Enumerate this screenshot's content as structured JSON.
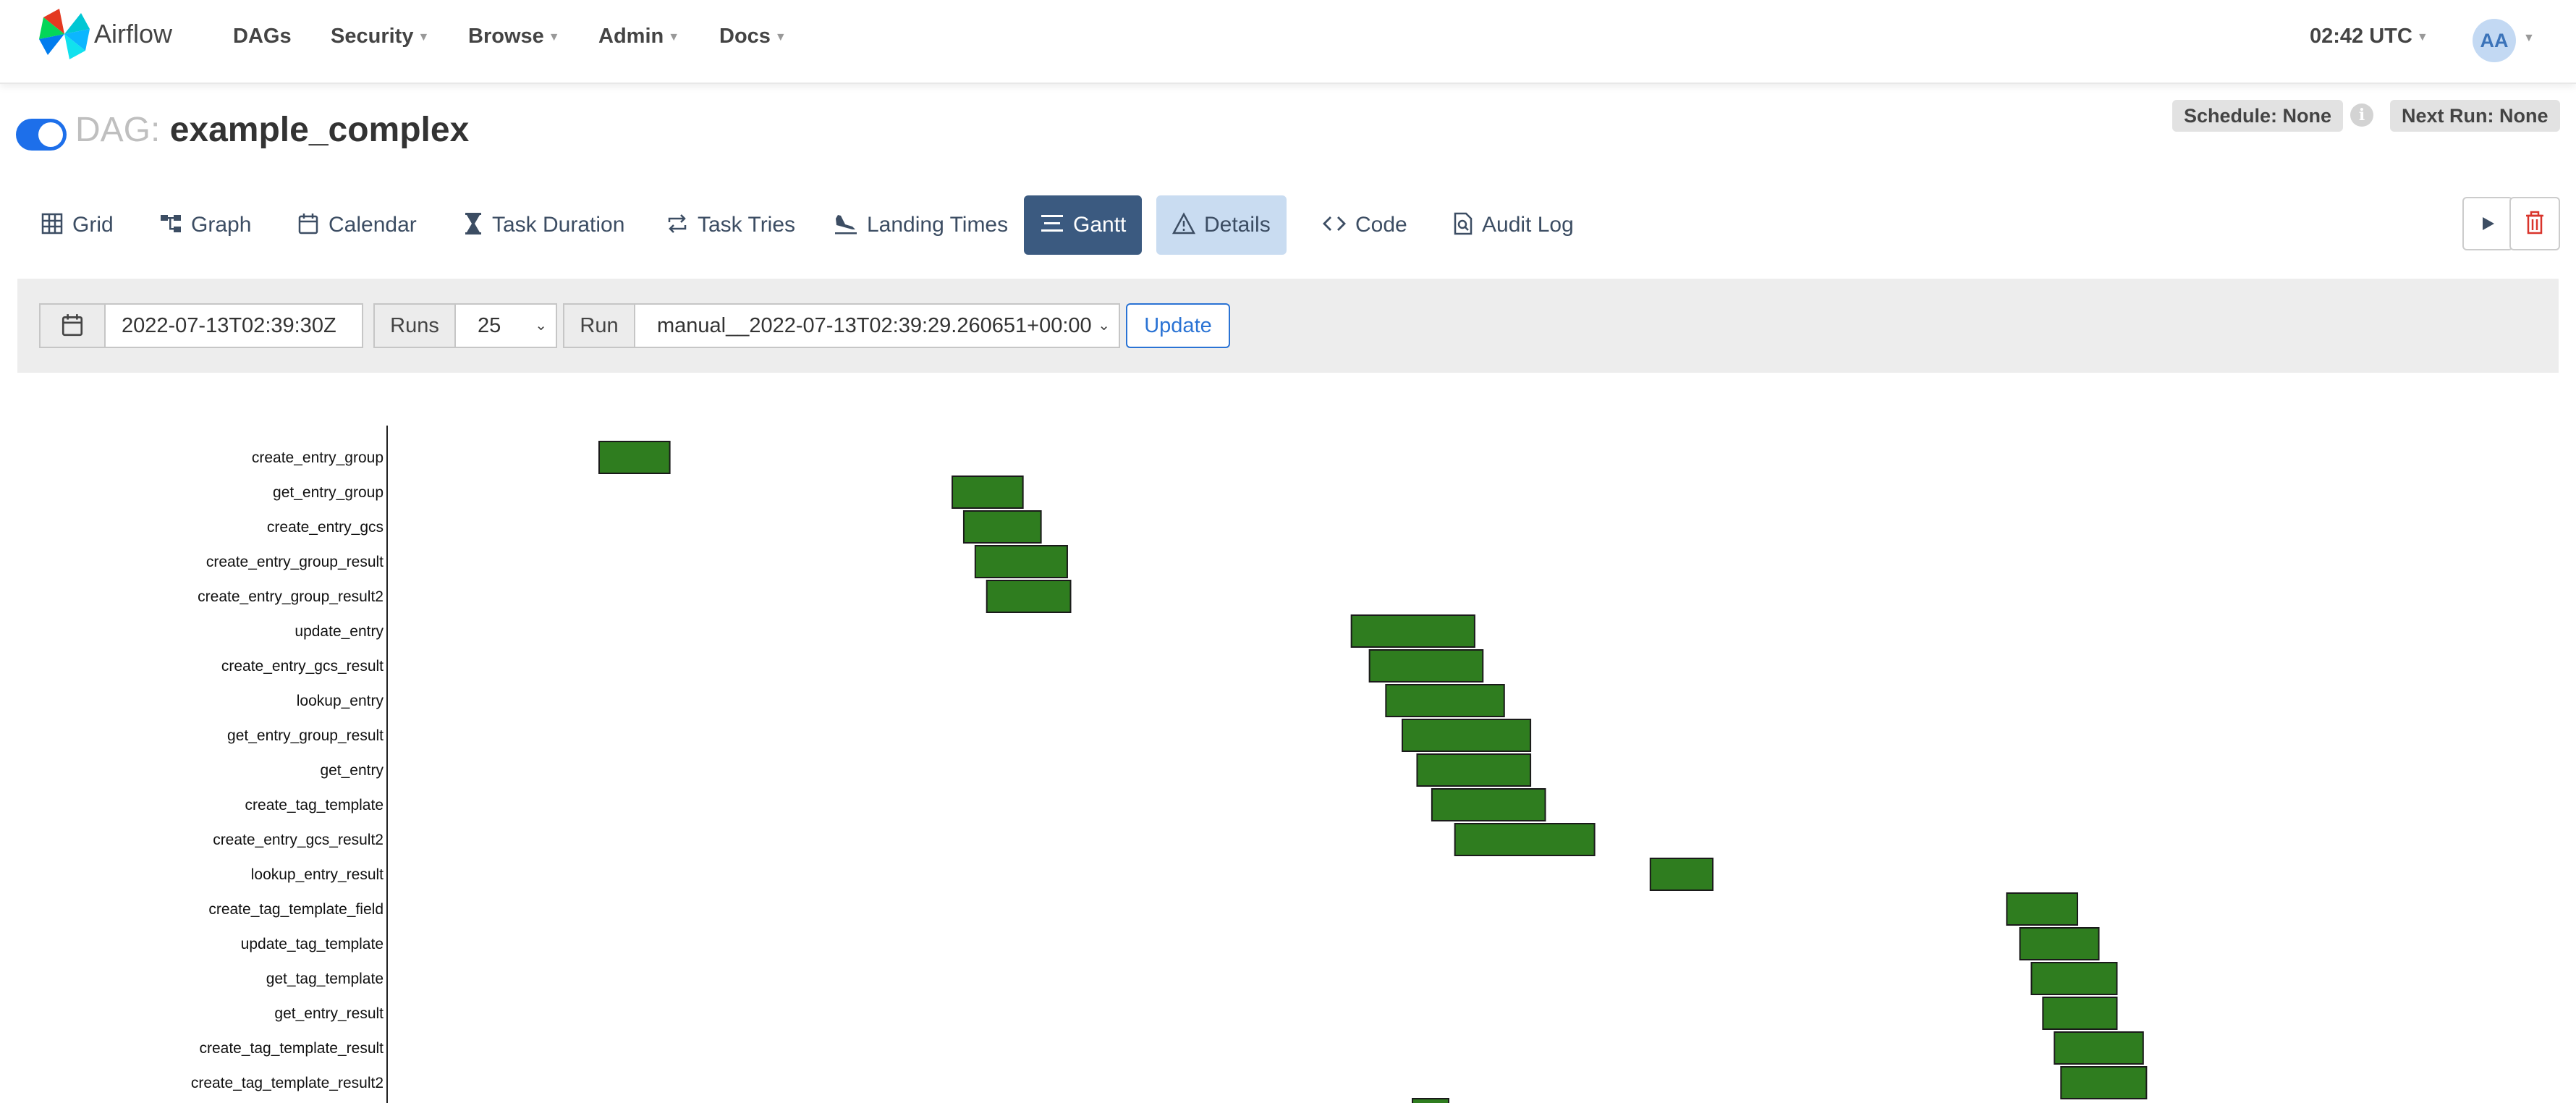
{
  "navbar": {
    "brand": "Airflow",
    "items": [
      {
        "label": "DAGs",
        "dropdown": false
      },
      {
        "label": "Security",
        "dropdown": true
      },
      {
        "label": "Browse",
        "dropdown": true
      },
      {
        "label": "Admin",
        "dropdown": true
      },
      {
        "label": "Docs",
        "dropdown": true
      }
    ],
    "clock": "02:42 UTC",
    "user_initials": "AA"
  },
  "dag": {
    "prefix": "DAG:",
    "name": "example_complex",
    "paused": false,
    "schedule": "Schedule: None",
    "next_run": "Next Run: None"
  },
  "tabs": [
    {
      "label": "Grid",
      "icon": "grid-icon"
    },
    {
      "label": "Graph",
      "icon": "graph-icon"
    },
    {
      "label": "Calendar",
      "icon": "calendar-icon"
    },
    {
      "label": "Task Duration",
      "icon": "hourglass-icon"
    },
    {
      "label": "Task Tries",
      "icon": "repeat-icon"
    },
    {
      "label": "Landing Times",
      "icon": "plane-landing-icon"
    },
    {
      "label": "Gantt",
      "icon": "gantt-icon",
      "active": true
    },
    {
      "label": "Details",
      "icon": "warning-triangle-icon"
    },
    {
      "label": "Code",
      "icon": "code-icon"
    },
    {
      "label": "Audit Log",
      "icon": "file-search-icon"
    }
  ],
  "actions": {
    "trigger_icon": "play-icon",
    "delete_icon": "trash-icon"
  },
  "filters": {
    "date_value": "2022-07-13T02:39:30Z",
    "runs_label": "Runs",
    "runs_value": "25",
    "run_label": "Run",
    "run_value": "manual__2022-07-13T02:39:29.260651+00:00",
    "update_label": "Update"
  },
  "colors": {
    "bar": "#2f7d1f",
    "accent": "#3b5a80",
    "toggle": "#1d6fea"
  },
  "chart_data": {
    "type": "gantt",
    "time_unit": "seconds since DAG run start",
    "tasks": [
      {
        "name": "create_entry_group",
        "start": 0.0,
        "end": 0.43
      },
      {
        "name": "get_entry_group",
        "start": 2.15,
        "end": 2.58
      },
      {
        "name": "create_entry_gcs",
        "start": 2.22,
        "end": 2.69
      },
      {
        "name": "create_entry_group_result",
        "start": 2.29,
        "end": 2.85
      },
      {
        "name": "create_entry_group_result2",
        "start": 2.36,
        "end": 2.87
      },
      {
        "name": "update_entry",
        "start": 4.58,
        "end": 5.33
      },
      {
        "name": "create_entry_gcs_result",
        "start": 4.69,
        "end": 5.38
      },
      {
        "name": "lookup_entry",
        "start": 4.79,
        "end": 5.51
      },
      {
        "name": "get_entry_group_result",
        "start": 4.89,
        "end": 5.67
      },
      {
        "name": "get_entry",
        "start": 4.98,
        "end": 5.67
      },
      {
        "name": "create_tag_template",
        "start": 5.07,
        "end": 5.76
      },
      {
        "name": "create_entry_gcs_result2",
        "start": 5.21,
        "end": 6.06
      },
      {
        "name": "lookup_entry_result",
        "start": 6.4,
        "end": 6.78
      },
      {
        "name": "create_tag_template_field",
        "start": 8.57,
        "end": 9.0
      },
      {
        "name": "update_tag_template",
        "start": 8.65,
        "end": 9.13
      },
      {
        "name": "get_tag_template",
        "start": 8.72,
        "end": 9.24
      },
      {
        "name": "get_entry_result",
        "start": 8.79,
        "end": 9.24
      },
      {
        "name": "create_tag_template_result",
        "start": 8.86,
        "end": 9.4
      },
      {
        "name": "create_tag_template_result2",
        "start": 8.9,
        "end": 9.42
      }
    ]
  }
}
